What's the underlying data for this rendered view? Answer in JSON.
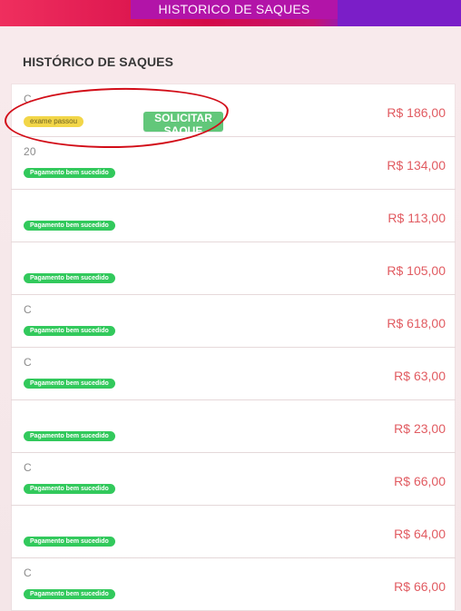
{
  "header": {
    "title": "HISTORICO DE SAQUES"
  },
  "main": {
    "heading": "HISTÓRICO DE SAQUES",
    "withdrawals": [
      {
        "id": "C",
        "status": "exame passou",
        "button": "SOLICITAR SAQUE",
        "amount": "R$ 186,00",
        "kind": "pending"
      },
      {
        "id": "20",
        "status": "Pagamento bem sucedido",
        "amount": "R$ 134,00",
        "kind": "success"
      },
      {
        "id": "",
        "status": "Pagamento bem sucedido",
        "amount": "R$ 113,00",
        "kind": "success"
      },
      {
        "id": "",
        "status": "Pagamento bem sucedido",
        "amount": "R$ 105,00",
        "kind": "success"
      },
      {
        "id": "C",
        "status": "Pagamento bem sucedido",
        "amount": "R$ 618,00",
        "kind": "success"
      },
      {
        "id": "C",
        "status": "Pagamento bem sucedido",
        "amount": "R$ 63,00",
        "kind": "success"
      },
      {
        "id": "",
        "status": "Pagamento bem sucedido",
        "amount": "R$ 23,00",
        "kind": "success"
      },
      {
        "id": "C",
        "status": "Pagamento bem sucedido",
        "amount": "R$ 66,00",
        "kind": "success"
      },
      {
        "id": "",
        "status": "Pagamento bem sucedido",
        "amount": "R$ 64,00",
        "kind": "success"
      },
      {
        "id": "C",
        "status": "Pagamento bem sucedido",
        "amount": "R$ 66,00",
        "kind": "success"
      }
    ]
  },
  "colors": {
    "header_red": "#d40a48",
    "header_purple": "#7b1ec8",
    "success_badge": "#32c95c",
    "pending_badge": "#f2d648",
    "withdraw_button": "#62c77a",
    "amount": "#e15b61",
    "annotation_circle": "#d20d18"
  }
}
